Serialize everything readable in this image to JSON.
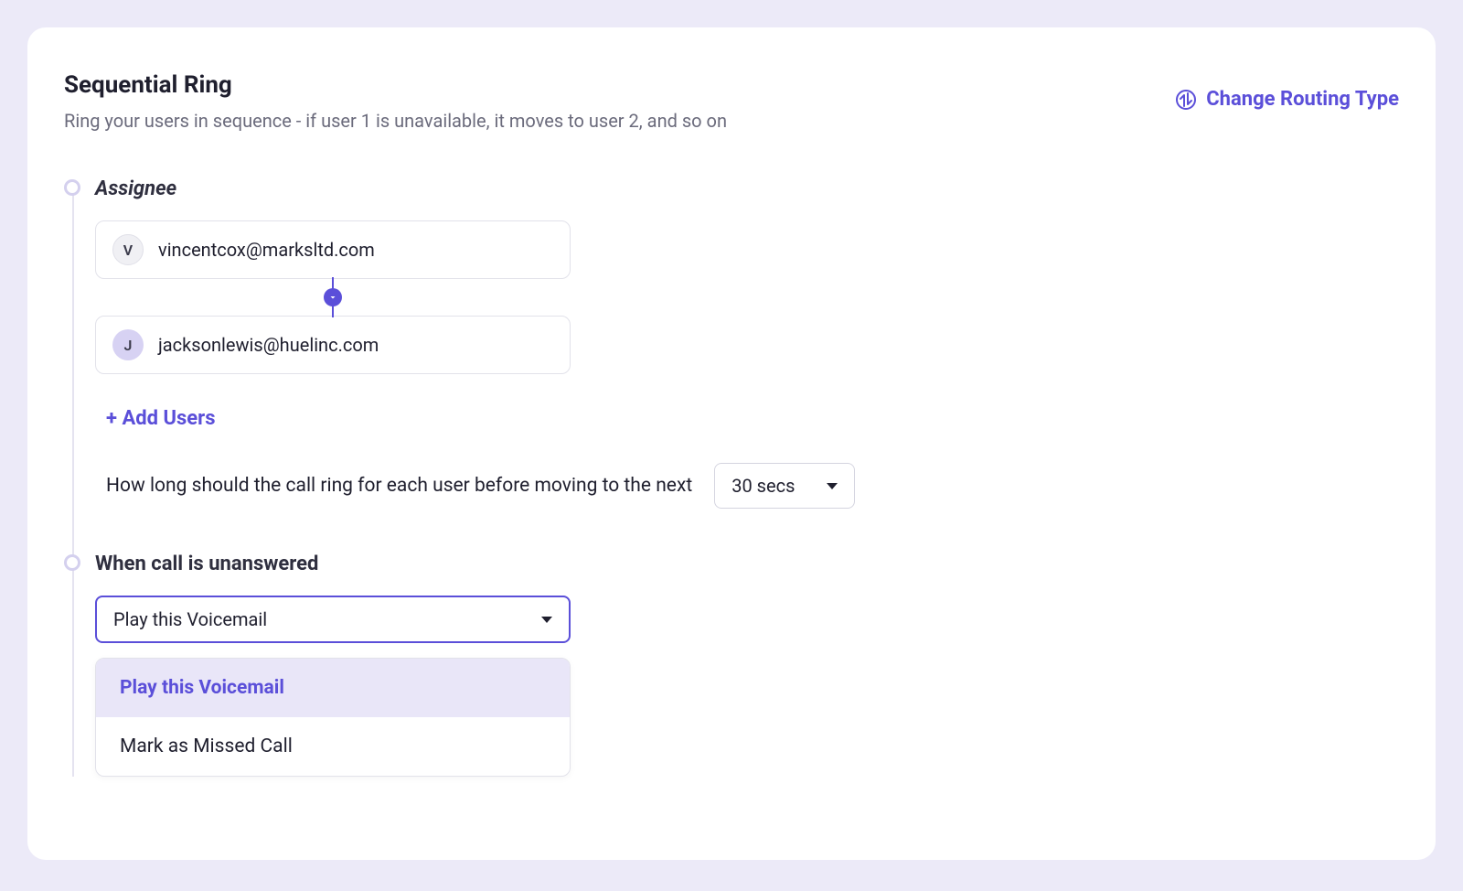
{
  "header": {
    "title": "Sequential Ring",
    "subtitle": "Ring your users in sequence - if user 1 is unavailable, it moves to user 2, and so on",
    "change_routing_label": "Change Routing Type"
  },
  "assignee": {
    "section_label": "Assignee",
    "users": [
      {
        "initial": "V",
        "email": "vincentcox@marksltd.com",
        "avatar_style": "gray"
      },
      {
        "initial": "J",
        "email": "jacksonlewis@huelinc.com",
        "avatar_style": "purple"
      }
    ],
    "add_users_label": "+ Add Users",
    "ring_duration_label": "How long should the call ring for each user before moving to the next",
    "ring_duration_value": "30 secs"
  },
  "unanswered": {
    "section_label": "When call is unanswered",
    "selected_value": "Play this Voicemail",
    "options": [
      {
        "label": "Play this Voicemail",
        "selected": true
      },
      {
        "label": "Mark as Missed Call",
        "selected": false
      }
    ]
  }
}
